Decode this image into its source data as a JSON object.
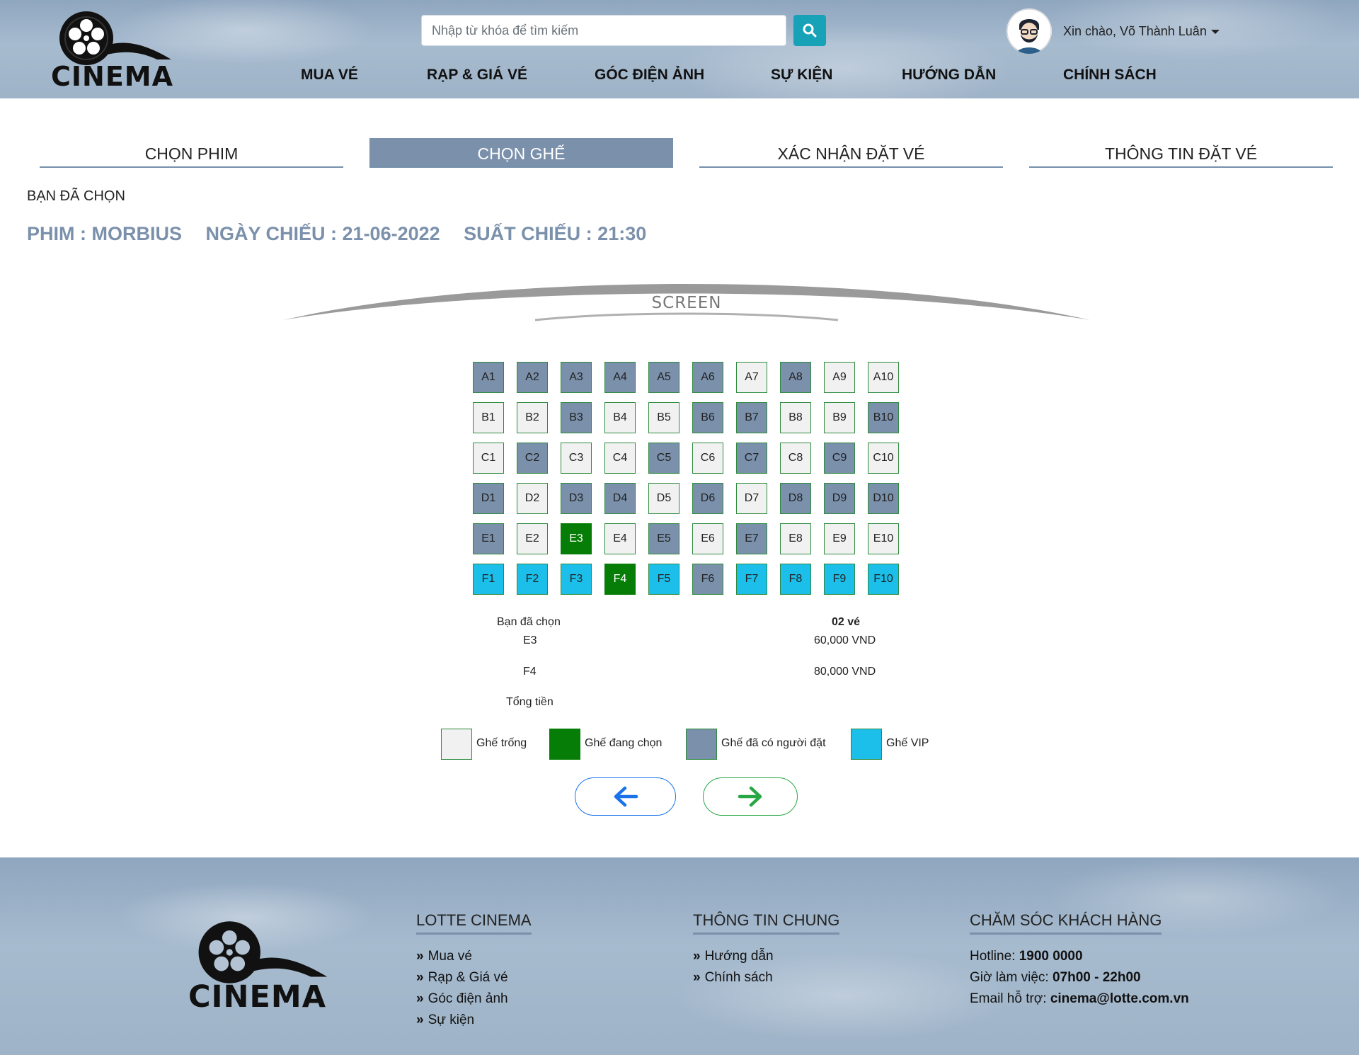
{
  "header": {
    "logo_text": "CINEMA",
    "search_placeholder": "Nhập từ khóa để tìm kiếm",
    "greeting": "Xin chào, Võ Thành Luân",
    "nav": [
      "MUA VÉ",
      "RẠP & GIÁ VÉ",
      "GÓC ĐIỆN ẢNH",
      "SỰ KIỆN",
      "HƯỚNG DẪN",
      "CHÍNH SÁCH"
    ]
  },
  "steps": [
    {
      "label": "CHỌN PHIM",
      "active": false
    },
    {
      "label": "CHỌN GHẾ",
      "active": true
    },
    {
      "label": "XÁC NHẬN ĐẶT VÉ",
      "active": false
    },
    {
      "label": "THÔNG TIN ĐẶT VÉ",
      "active": false
    }
  ],
  "selection": {
    "label": "BẠN ĐÃ CHỌN",
    "movie": "PHIM : MORBIUS",
    "date": "NGÀY CHIẾU : 21-06-2022",
    "showtime": "SUẤT CHIẾU : 21:30"
  },
  "screen_label": "SCREEN",
  "seats": [
    {
      "row": "A",
      "states": [
        "taken",
        "taken",
        "taken",
        "taken",
        "taken",
        "taken",
        "empty",
        "taken",
        "empty",
        "empty"
      ]
    },
    {
      "row": "B",
      "states": [
        "empty",
        "empty",
        "taken",
        "empty",
        "empty",
        "taken",
        "taken",
        "empty",
        "empty",
        "taken"
      ]
    },
    {
      "row": "C",
      "states": [
        "empty",
        "taken",
        "empty",
        "empty",
        "taken",
        "empty",
        "taken",
        "empty",
        "taken",
        "empty"
      ]
    },
    {
      "row": "D",
      "states": [
        "taken",
        "empty",
        "taken",
        "taken",
        "empty",
        "taken",
        "empty",
        "taken",
        "taken",
        "taken"
      ]
    },
    {
      "row": "E",
      "states": [
        "taken",
        "empty",
        "selected",
        "empty",
        "taken",
        "empty",
        "taken",
        "empty",
        "empty",
        "empty"
      ]
    },
    {
      "row": "F",
      "states": [
        "vip",
        "vip",
        "vip",
        "selected",
        "vip",
        "taken",
        "vip",
        "vip",
        "vip",
        "vip"
      ]
    }
  ],
  "summary": {
    "chosen_label": "Bạn đã chọn",
    "ticket_count": "02 vé",
    "items": [
      {
        "seat": "E3",
        "price": "60,000 VND"
      },
      {
        "seat": "F4",
        "price": "80,000 VND"
      }
    ],
    "total_label": "Tổng tiền"
  },
  "legend": [
    {
      "label": "Ghế trống",
      "color": "#f1f1f1"
    },
    {
      "label": "Ghế đang chọn",
      "color": "#067d06"
    },
    {
      "label": "Ghế đã có người đặt",
      "color": "#7a90ab"
    },
    {
      "label": "Ghế VIP",
      "color": "#1bbfea"
    }
  ],
  "buttons": {
    "back_icon": "arrow-left-icon",
    "next_icon": "arrow-right-icon",
    "back_color": "#1a73e8",
    "next_color": "#28a745"
  },
  "footer": {
    "logo_text": "CINEMA",
    "col1": {
      "title": "LOTTE CINEMA",
      "links": [
        "Mua vé",
        "Rạp & Giá vé",
        "Góc điện ảnh",
        "Sự kiện"
      ]
    },
    "col2": {
      "title": "THÔNG TIN CHUNG",
      "links": [
        "Hướng dẫn",
        "Chính sách"
      ]
    },
    "col3": {
      "title": "CHĂM SÓC KHÁCH HÀNG",
      "hotline_label": "Hotline:",
      "hotline": "1900 0000",
      "hours_label": "Giờ làm việc:",
      "hours": "07h00 - 22h00",
      "email_label": "Email hỗ trợ:",
      "email": "cinema@lotte.com.vn"
    }
  }
}
